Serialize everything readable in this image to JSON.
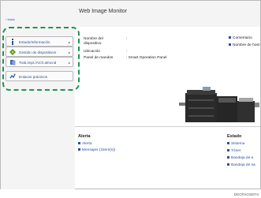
{
  "app": {
    "title": "Web Image Monitor",
    "back_link": "‹ Inicio"
  },
  "sidebar": {
    "items": [
      {
        "label": "Estado/Información",
        "icon": "info-icon"
      },
      {
        "label": "Gestión de dispositivos",
        "icon": "device-management-icon"
      },
      {
        "label": "Trab.impr./Arch.almcnd",
        "icon": "print-job-icon"
      },
      {
        "label": "Enlaces prácticos",
        "icon": "link-icon"
      }
    ]
  },
  "device_info": {
    "rows": [
      {
        "label": "Nombre del dispositivo",
        "value": ":"
      },
      {
        "label": "Ubicación",
        "value": ":"
      },
      {
        "label": "Panel de mandos",
        "value": ": Smart Operation Panel"
      }
    ],
    "right_links": [
      "Comentario",
      "Nombre de host"
    ]
  },
  "alerta": {
    "title": "Alerta",
    "items": [
      "Alerta",
      "Mensajes (1item(s))"
    ]
  },
  "estado": {
    "title": "Estado",
    "items": [
      "Sistema",
      "Tóner",
      "Bandeja de e",
      "Bandeja de sa"
    ]
  },
  "caption": "DGCPAC04074",
  "colors": {
    "highlight": "#1f9456",
    "link": "#2b4f9e",
    "info_icon": "#2b4f9e",
    "device_icon": "#4f9a2e",
    "print_icon": "#3e66b8"
  }
}
